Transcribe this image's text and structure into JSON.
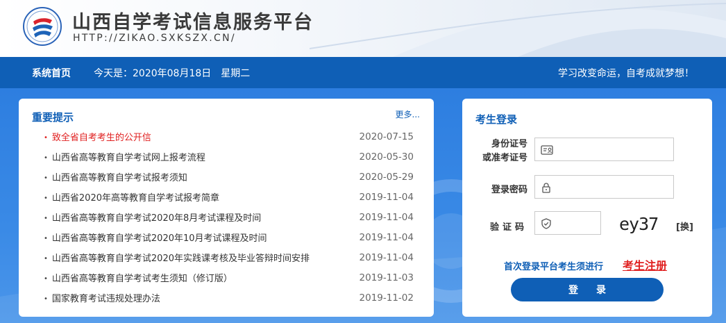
{
  "header": {
    "site_title": "山西自学考试信息服务平台",
    "site_url": "HTTP://ZIKAO.SXKSZX.CN/"
  },
  "nav": {
    "home": "系统首页",
    "date_prefix": "今天是：2020年08月18日",
    "weekday": "星期二",
    "slogan": "学习改变命运，自考成就梦想！"
  },
  "notices": {
    "title": "重要提示",
    "more": "更多...",
    "items": [
      {
        "title": "致全省自考考生的公开信",
        "date": "2020-07-15",
        "highlight": true
      },
      {
        "title": "山西省高等教育自学考试网上报考流程",
        "date": "2020-05-30"
      },
      {
        "title": "山西省高等教育自学考试报考须知",
        "date": "2020-05-29"
      },
      {
        "title": "山西省2020年高等教育自学考试报考简章",
        "date": "2019-11-04"
      },
      {
        "title": "山西省高等教育自学考试2020年8月考试课程及时间",
        "date": "2019-11-04"
      },
      {
        "title": "山西省高等教育自学考试2020年10月考试课程及时间",
        "date": "2019-11-04"
      },
      {
        "title": "山西省高等教育自学考试2020年实践课考核及毕业答辩时间安排",
        "date": "2019-11-04"
      },
      {
        "title": "山西省高等教育自学考试考生须知（修订版）",
        "date": "2019-11-03"
      },
      {
        "title": "国家教育考试违规处理办法",
        "date": "2019-11-02"
      }
    ]
  },
  "login": {
    "title": "考生登录",
    "id_label_line1": "身份证号",
    "id_label_line2": "或准考证号",
    "password_label": "登录密码",
    "captcha_label": "验证码",
    "captcha_text": "ey37",
    "captcha_refresh": "[换]",
    "register_hint": "首次登录平台考生须进行",
    "register_link": "考生注册",
    "login_button": "登录"
  },
  "colors": {
    "brand_blue": "#0f5fb6",
    "highlight_red": "#e02020"
  }
}
